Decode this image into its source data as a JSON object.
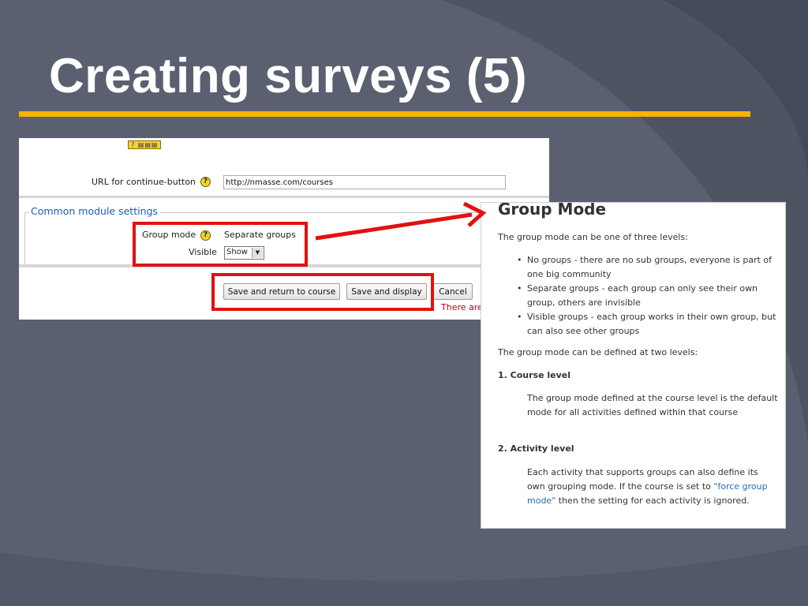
{
  "slide": {
    "title": "Creating surveys (5)",
    "accent_color": "#f5b400",
    "background_color": "#5a6070"
  },
  "form": {
    "url_label": "URL for continue-button",
    "url_value": "http://nmasse.com/courses",
    "section_legend": "Common module settings",
    "group_mode_label": "Group mode",
    "group_mode_value": "Separate groups",
    "visible_label": "Visible",
    "visible_value": "Show",
    "buttons": {
      "save_return": "Save and return to course",
      "save_display": "Save and display",
      "cancel": "Cancel"
    },
    "required_note": "There are"
  },
  "help": {
    "title": "Group Mode",
    "intro": "The group mode can be one of three levels:",
    "levels": [
      "No groups - there are no sub groups, everyone is part of one big community",
      "Separate groups - each group can only see their own group, others are invisible",
      "Visible groups - each group works in their own group, but can also see other groups"
    ],
    "defined_intro": "The group mode can be defined at two levels:",
    "course_heading": "1. Course level",
    "course_text": "The group mode defined at the course level is the default mode for all activities defined within that course",
    "activity_heading": "2. Activity level",
    "activity_text_before": "Each activity that supports groups can also define its own grouping mode. If the course is set to ",
    "activity_link": "\"force group mode\"",
    "activity_text_after": " then the setting for each activity is ignored."
  },
  "annotation": {
    "highlight_color": "#e0120f"
  }
}
